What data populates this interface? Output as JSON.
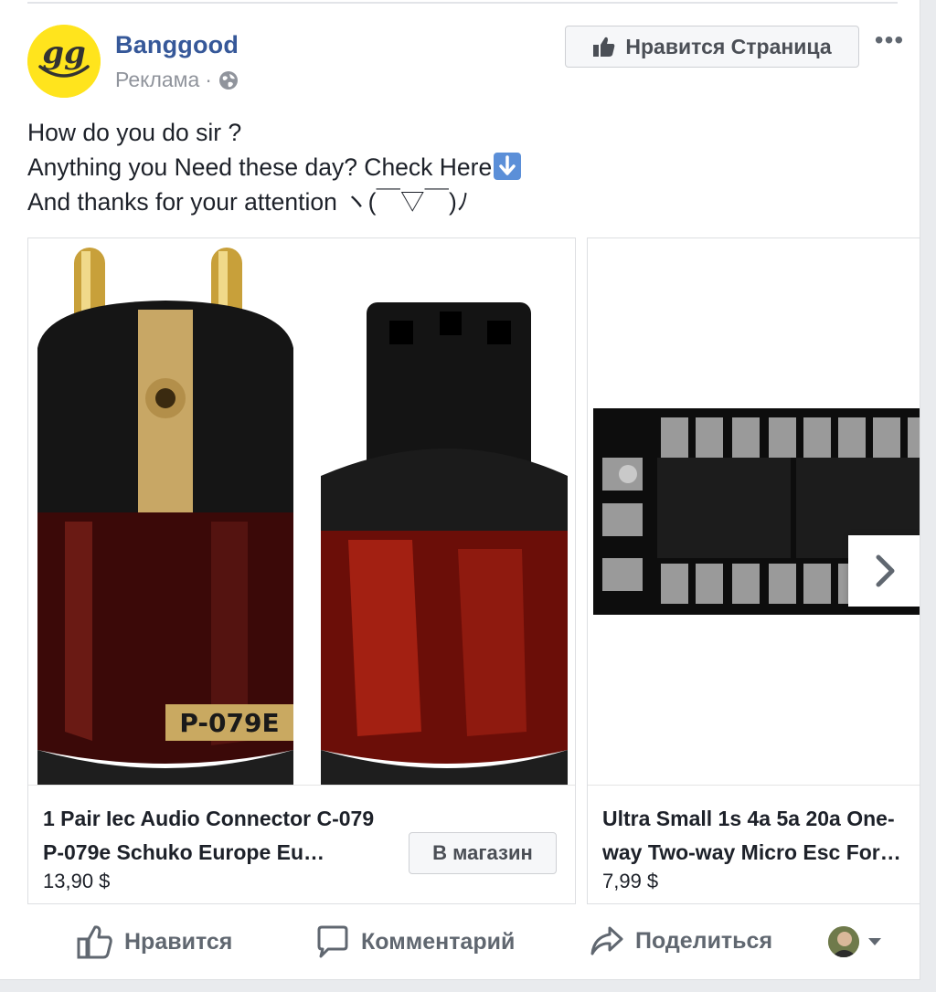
{
  "post": {
    "page_name": "Banggood",
    "sponsored_label": "Реклама",
    "meta_separator": "·",
    "like_page_label": "Нравится Страница",
    "more_label": "•••",
    "avatar_text": "gg",
    "message_lines": [
      "How do you do sir ?",
      "Anything you Need these day? Check Here",
      "And thanks for your attention ヽ(￣▽￣)ﾉ"
    ]
  },
  "carousel": {
    "cards": [
      {
        "title": "1 Pair Iec Audio Connector C-079 P-079e Schuko Europe Eu…",
        "price": "13,90 $",
        "cta": "В магазин",
        "image_label": "P-079E"
      },
      {
        "title": "Ultra Small 1s 4a 5a 20a One-way Two-way Micro Esc For…",
        "price": "7,99 $"
      }
    ]
  },
  "actions": {
    "like": "Нравится",
    "comment": "Комментарий",
    "share": "Поделиться"
  },
  "colors": {
    "link": "#365899",
    "text": "#1d2129",
    "muted": "#606770",
    "avatar_bg": "#ffe41d"
  }
}
